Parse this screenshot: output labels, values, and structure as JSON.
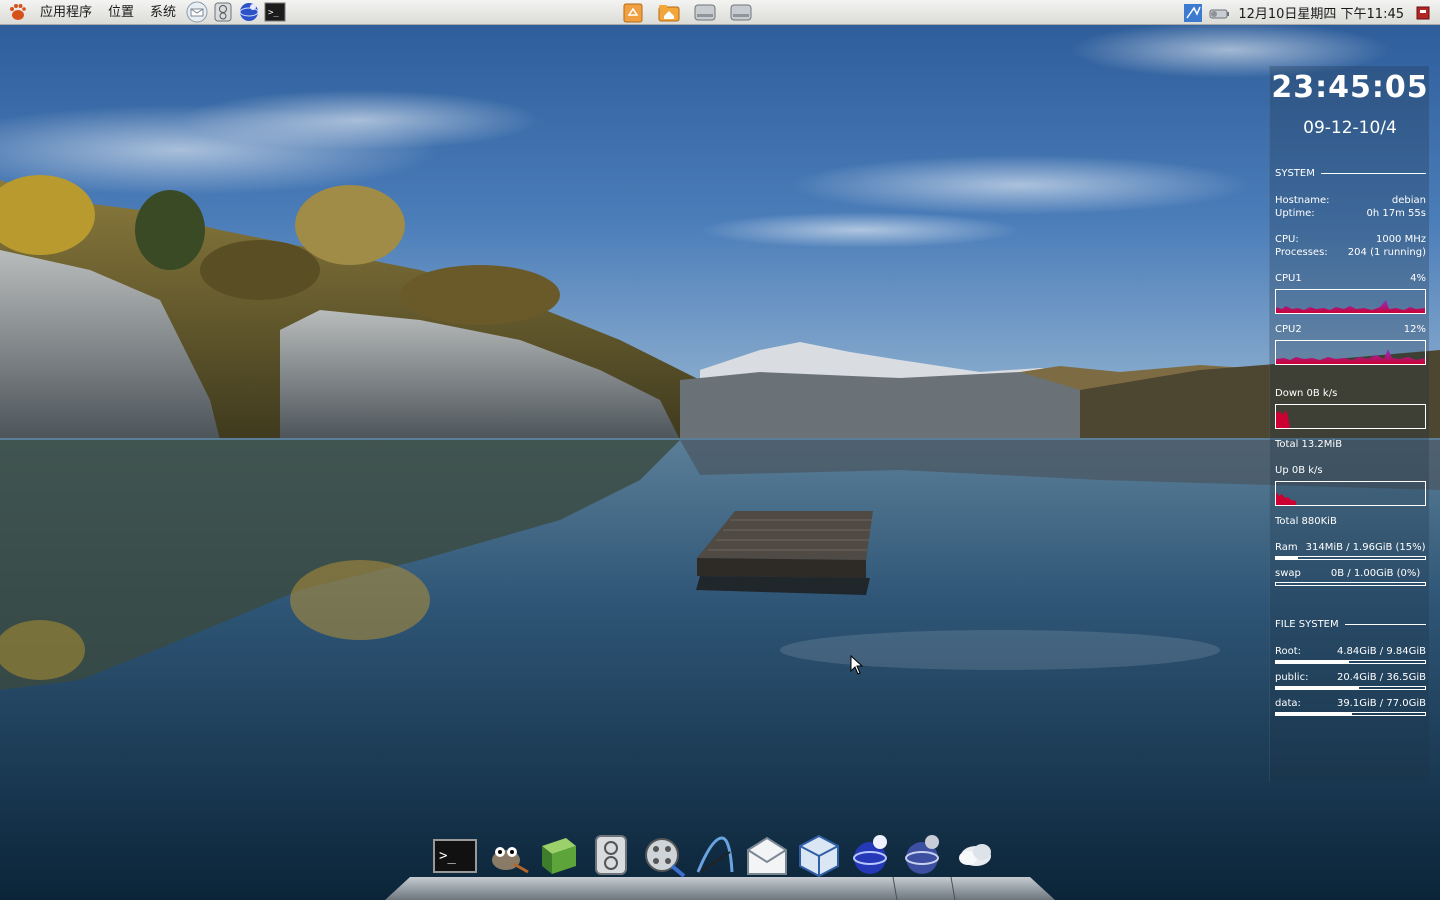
{
  "top_panel": {
    "menus": [
      "应用程序",
      "位置",
      "系统"
    ],
    "quick_launch_icons": [
      "mail-icon",
      "disk-utility-icon",
      "browser-icon",
      "terminal-icon"
    ],
    "center_launchers": [
      "recycle-bin-icon",
      "home-folder-icon",
      "drive-icon",
      "drive-icon"
    ],
    "tray_icons": [
      "network-indicator-icon",
      "battery-icon"
    ],
    "clock": "12月10日星期四 下午11:45",
    "shutdown_icon": "power-icon"
  },
  "conky": {
    "time": "23:45:05",
    "date": "09-12-10/4",
    "system_header": "SYSTEM",
    "hostname_label": "Hostname:",
    "hostname_value": "debian",
    "uptime_label": "Uptime:",
    "uptime_value": "0h 17m 55s",
    "cpu_label": "CPU:",
    "cpu_value": "1000 MHz",
    "processes_label": "Processes:",
    "processes_value": "204 (1 running)",
    "cpu1_label": "CPU1",
    "cpu1_value": "4%",
    "cpu2_label": "CPU2",
    "cpu2_value": "12%",
    "down_label": "Down 0B   k/s",
    "down_total": "Total 13.2MiB",
    "up_label": "Up 0B   k/s",
    "up_total": "Total 880KiB",
    "ram_label": "Ram",
    "ram_value": "314MiB / 1.96GiB (15%)",
    "ram_fraction": 0.15,
    "swap_label": "swap",
    "swap_value": "0B   / 1.00GiB (0%)",
    "swap_fraction": 0.0,
    "fs_header": "FILE SYSTEM",
    "root_label": "Root:",
    "root_value": "4.84GiB / 9.84GiB",
    "root_fraction": 0.49,
    "public_label": "public:",
    "public_value": "20.4GiB / 36.5GiB",
    "public_fraction": 0.56,
    "data_label": "data:",
    "data_value": "39.1GiB / 77.0GiB",
    "data_fraction": 0.51
  },
  "dock": {
    "icons": [
      "terminal-icon",
      "gimp-icon",
      "dictionary-icon",
      "disk-utility-icon",
      "video-player-icon",
      "inkscape-icon",
      "mail-icon",
      "virtualbox-icon",
      "internet-icon",
      "internet-icon",
      "weather-icon"
    ]
  },
  "colors": {
    "panel_bg": "#e8e8e6",
    "graph_red": "#cc0033",
    "graph_purple": "#8833cc",
    "text_white": "#ffffff"
  }
}
